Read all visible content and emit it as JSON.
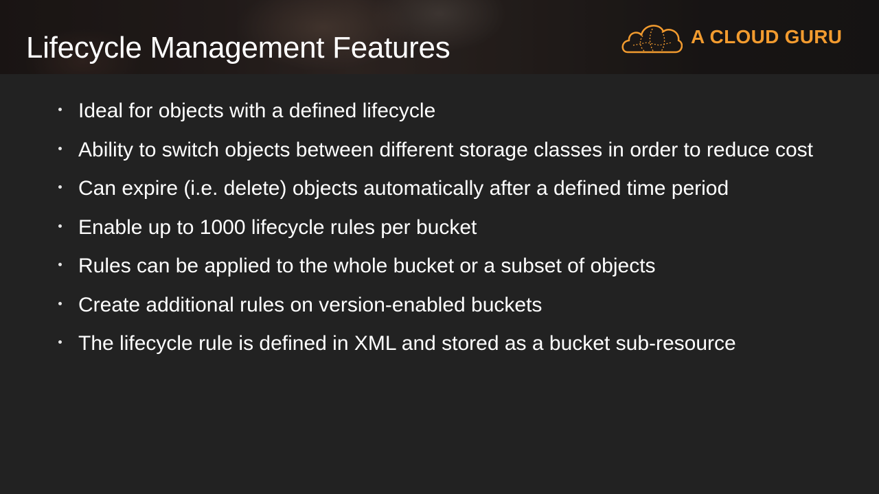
{
  "slide": {
    "title": "Lifecycle Management Features",
    "brand": {
      "name": "A CLOUD GURU",
      "icon": "cloud-logo-icon",
      "color": "#f29b2f"
    },
    "bullets": [
      "Ideal for objects with a defined lifecycle",
      "Ability to switch objects between different storage classes in order to reduce cost",
      "Can expire (i.e. delete) objects automatically after a defined time period",
      "Enable up to 1000 lifecycle rules per bucket",
      "Rules can be applied to the whole bucket or a subset of objects",
      "Create additional rules on version-enabled buckets",
      "The lifecycle rule is defined in XML and stored as a bucket sub-resource"
    ]
  }
}
